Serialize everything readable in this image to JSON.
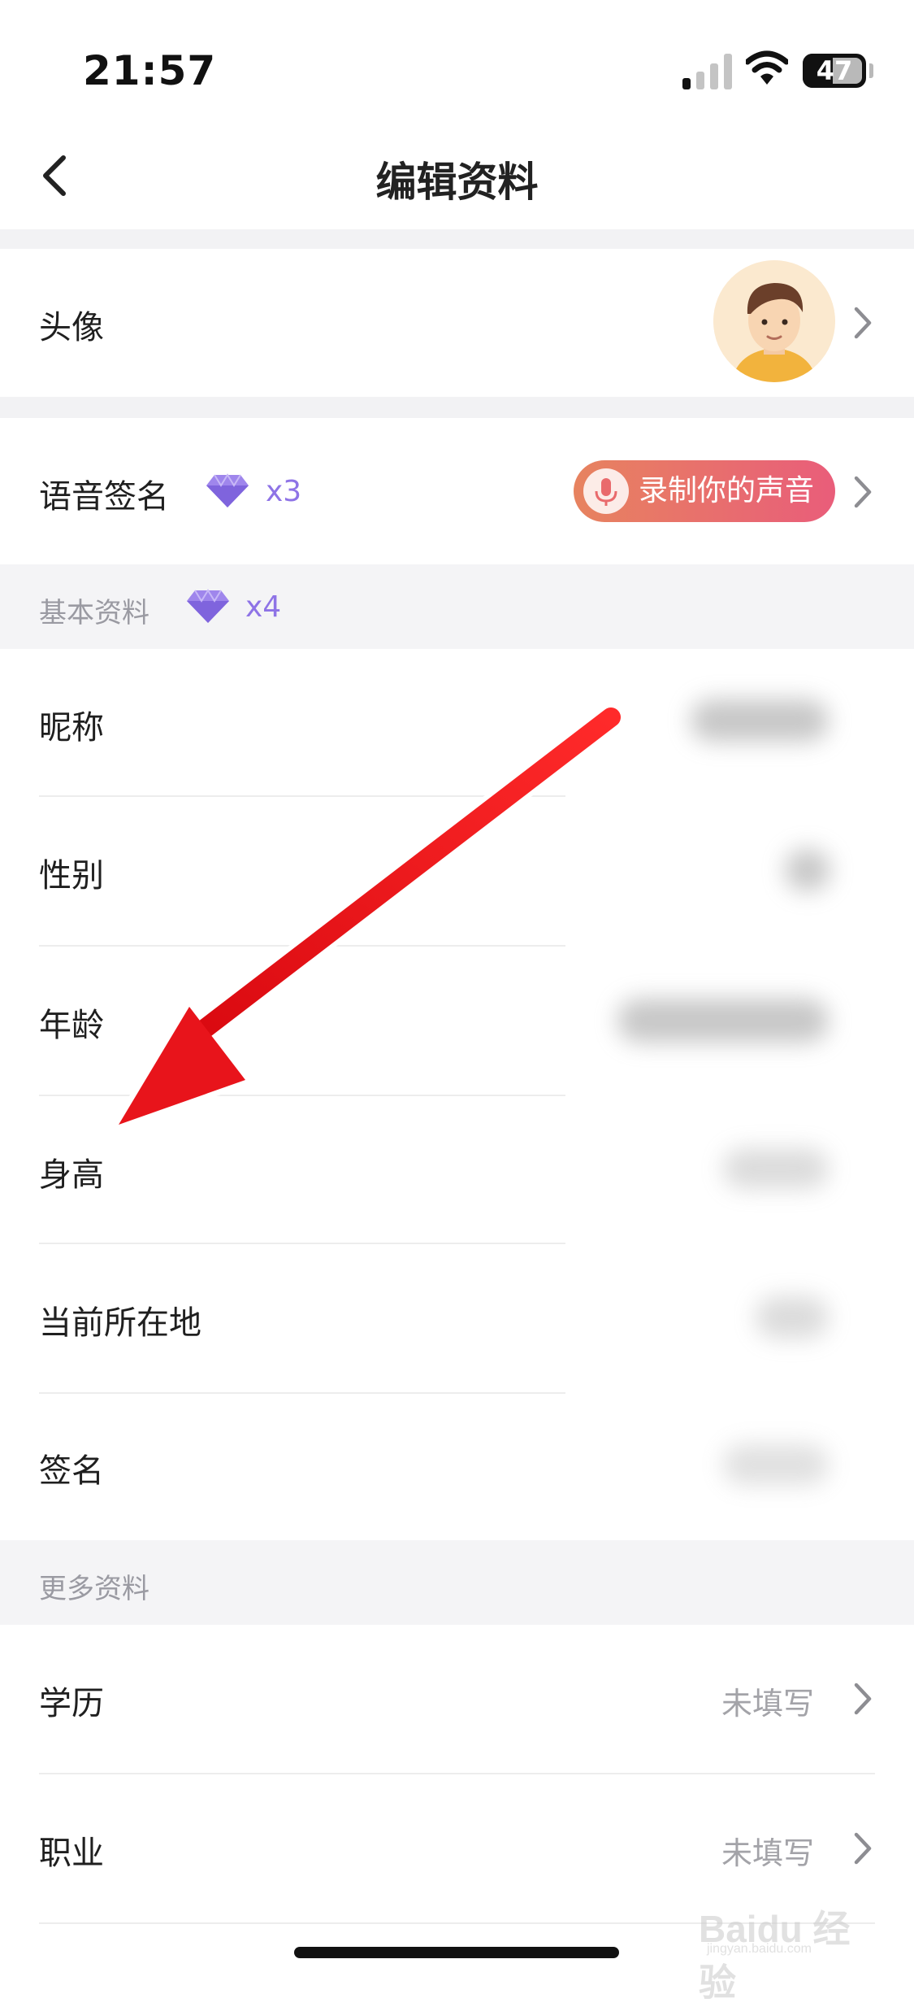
{
  "status": {
    "time": "21:57",
    "battery": "47",
    "battery_fraction": 0.47
  },
  "nav": {
    "title": "编辑资料"
  },
  "avatar_row": {
    "label": "头像"
  },
  "voice_row": {
    "label": "语音签名",
    "gem_count": "x3",
    "record_label": "录制你的声音"
  },
  "basic_section": {
    "title": "基本资料",
    "gem_count": "x4",
    "items": [
      {
        "label": "昵称"
      },
      {
        "label": "性别"
      },
      {
        "label": "年龄"
      },
      {
        "label": "身高"
      },
      {
        "label": "当前所在地"
      },
      {
        "label": "签名"
      }
    ]
  },
  "more_section": {
    "title": "更多资料",
    "items": [
      {
        "label": "学历",
        "value": "未填写"
      },
      {
        "label": "职业",
        "value": "未填写"
      }
    ]
  },
  "watermark": {
    "text": "Baidu 经验",
    "sub": "jingyan.baidu.com"
  },
  "colors": {
    "accent_gem": "#8e73e6",
    "record_start": "#e7835f",
    "record_end": "#e95d7a",
    "annotation_arrow": "#e8141b"
  },
  "icons": [
    "back-icon",
    "chevron-right-icon",
    "diamond-icon",
    "microphone-icon",
    "avatar-image",
    "signal-icon",
    "wifi-icon",
    "battery-icon"
  ]
}
